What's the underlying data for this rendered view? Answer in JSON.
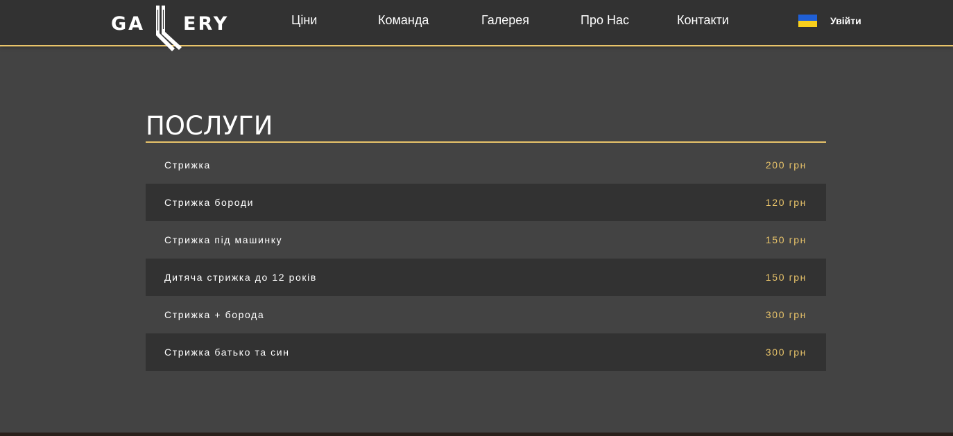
{
  "header": {
    "logo": {
      "left": "GA",
      "right": "ERY"
    },
    "nav": [
      {
        "label": "Ціни"
      },
      {
        "label": "Команда"
      },
      {
        "label": "Галерея"
      },
      {
        "label": "Про Нас"
      },
      {
        "label": "Контакти"
      }
    ],
    "flag_icon": "ukraine-flag-icon",
    "login_label": "Увійти"
  },
  "colors": {
    "accent": "#e9c46a",
    "header_bg": "#323232",
    "page_bg": "#434343",
    "row_dark": "#323232"
  },
  "services": {
    "title": "ПОСЛУГИ",
    "items": [
      {
        "name": "Стрижка",
        "price": "200 грн"
      },
      {
        "name": "Стрижка бороди",
        "price": "120 грн"
      },
      {
        "name": "Стрижка під машинку",
        "price": "150 грн"
      },
      {
        "name": "Дитяча стрижка до 12 років",
        "price": "150 грн"
      },
      {
        "name": "Стрижка + борода",
        "price": "300 грн"
      },
      {
        "name": "Стрижка батько та син",
        "price": "300 грн"
      }
    ]
  }
}
